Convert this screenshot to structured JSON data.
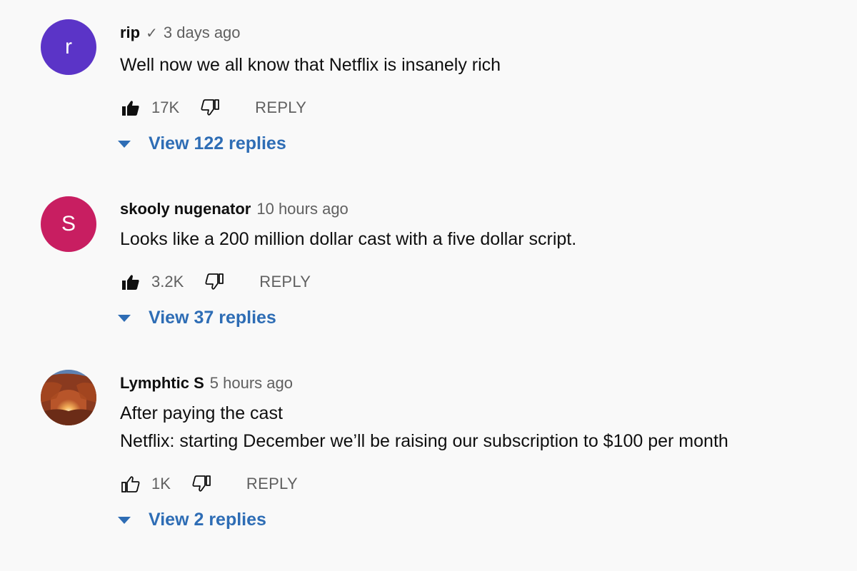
{
  "comments": [
    {
      "avatar_letter": "r",
      "avatar_color": "#5b34c7",
      "author": "rip",
      "verified": "✓",
      "time": "3 days ago",
      "lines": [
        "Well now we all know that Netflix is insanely rich"
      ],
      "likes": "17K",
      "liked": true,
      "reply_label": "REPLY",
      "view_replies": "View 122 replies"
    },
    {
      "avatar_letter": "S",
      "avatar_color": "#c81e61",
      "author": "skooly nugenator",
      "time": "10 hours ago",
      "lines": [
        "Looks like a 200 million dollar cast with a five dollar script."
      ],
      "likes": "3.2K",
      "liked": true,
      "reply_label": "REPLY",
      "view_replies": "View 37 replies"
    },
    {
      "avatar_type": "landscape-photo",
      "author": "Lymphtic S",
      "time": "5 hours ago",
      "lines": [
        "After paying the cast",
        "Netflix: starting December we’ll be raising our subscription to $100 per month"
      ],
      "likes": "1K",
      "liked": false,
      "reply_label": "REPLY",
      "view_replies": "View 2 replies"
    }
  ],
  "colors": {
    "background": "#f9f9f9",
    "link_blue": "#2e6db5",
    "meta_gray": "#606060"
  },
  "icons": {
    "like": "thumb-up-icon",
    "dislike": "thumb-down-icon",
    "expand": "caret-down-icon"
  }
}
